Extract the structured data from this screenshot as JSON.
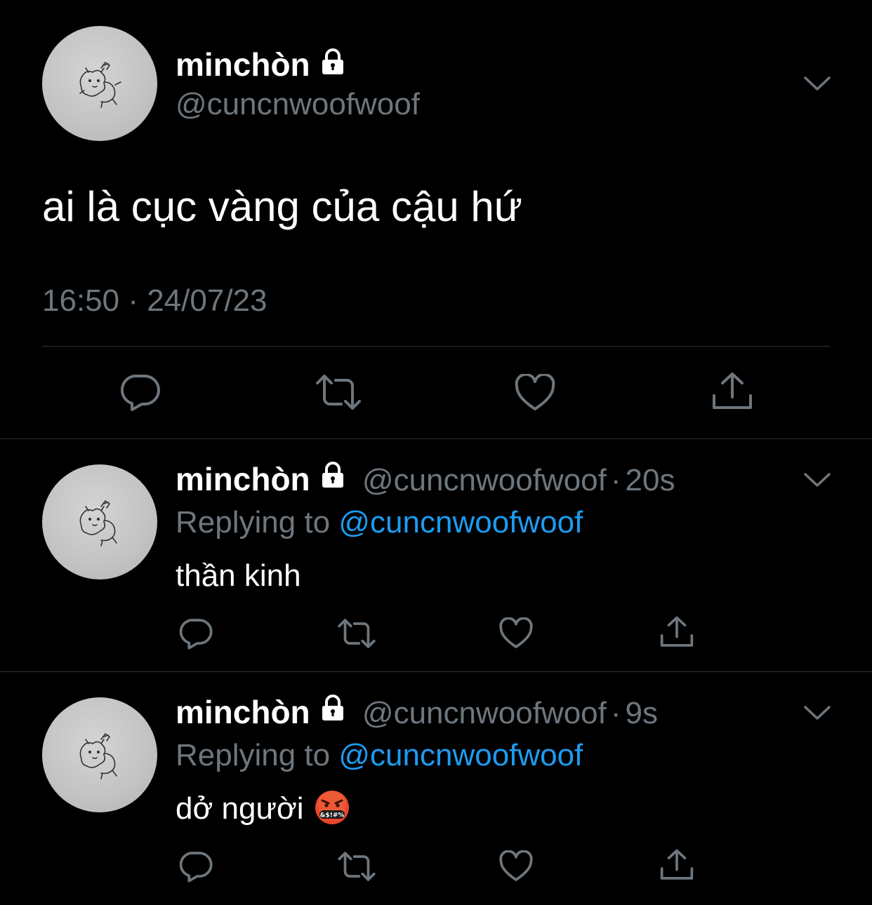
{
  "main_tweet": {
    "display_name": "minchòn",
    "handle": "@cuncnwoofwoof",
    "text": "ai là cục vàng của cậu hứ",
    "timestamp": "16:50 · 24/07/23"
  },
  "replies": [
    {
      "display_name": "minchòn",
      "handle": "@cuncnwoofwoof",
      "separator": "·",
      "time": "20s",
      "replying_prefix": "Replying to",
      "replying_to": "@cuncnwoofwoof",
      "text": "thần kinh"
    },
    {
      "display_name": "minchòn",
      "handle": "@cuncnwoofwoof",
      "separator": "·",
      "time": "9s",
      "replying_prefix": "Replying to",
      "replying_to": "@cuncnwoofwoof",
      "text": "dở người",
      "emoji": "cursing-face"
    }
  ],
  "icons": [
    "reply-icon",
    "retweet-icon",
    "like-icon",
    "share-icon",
    "lock-icon",
    "chevron-down-icon"
  ],
  "colors": {
    "background": "#000000",
    "text": "#ffffff",
    "secondary": "#6e767d",
    "link": "#1d9bf0",
    "divider": "#2f3336"
  }
}
